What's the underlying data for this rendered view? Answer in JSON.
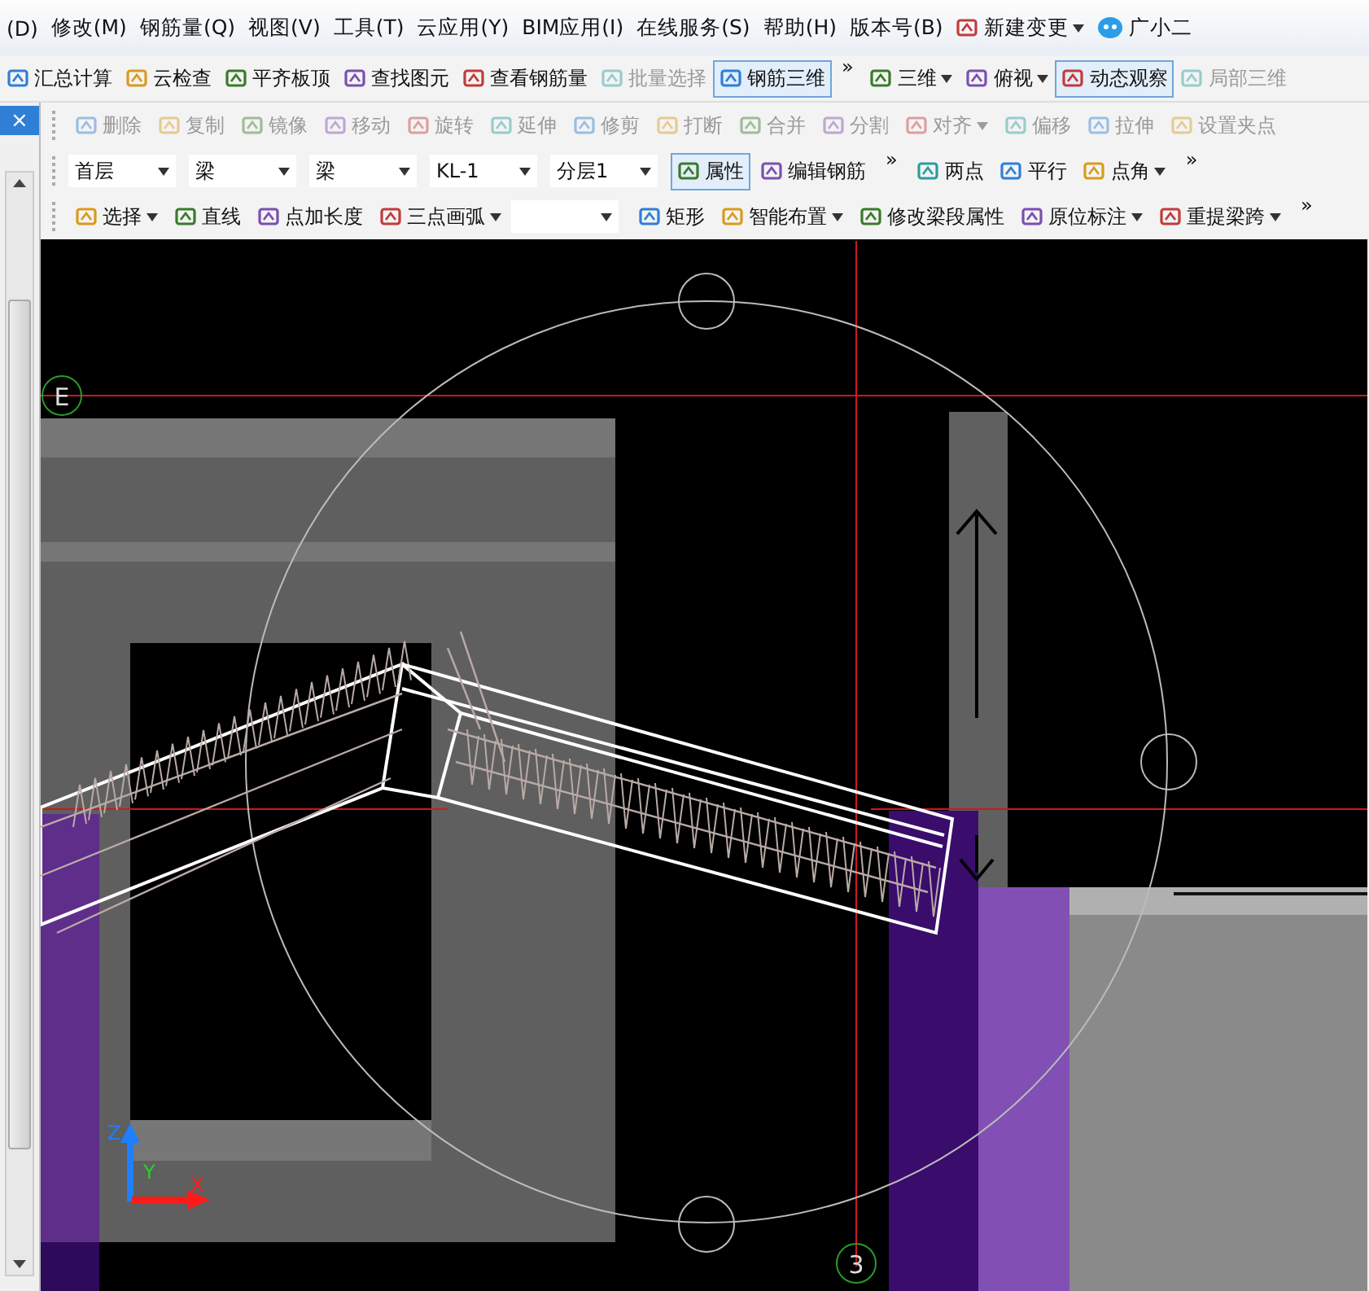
{
  "menu_bar": {
    "items": [
      {
        "label": "(D)",
        "kind": "menu"
      },
      {
        "label": "修改(M)",
        "kind": "menu"
      },
      {
        "label": "钢筋量(Q)",
        "kind": "menu"
      },
      {
        "label": "视图(V)",
        "kind": "menu"
      },
      {
        "label": "工具(T)",
        "kind": "menu"
      },
      {
        "label": "云应用(Y)",
        "kind": "menu"
      },
      {
        "label": "BIM应用(I)",
        "kind": "menu"
      },
      {
        "label": "在线服务(S)",
        "kind": "menu"
      },
      {
        "label": "帮助(H)",
        "kind": "menu"
      },
      {
        "label": "版本号(B)",
        "kind": "menu"
      },
      {
        "label": "新建变更",
        "kind": "dropdown"
      },
      {
        "label": "广小二",
        "kind": "button"
      }
    ]
  },
  "main_toolbar": [
    {
      "label": "汇总计算",
      "selected": false,
      "disabled": false,
      "dropdown": false
    },
    {
      "label": "云检查",
      "selected": false,
      "disabled": false,
      "dropdown": false
    },
    {
      "label": "平齐板顶",
      "selected": false,
      "disabled": false,
      "dropdown": false
    },
    {
      "label": "查找图元",
      "selected": false,
      "disabled": false,
      "dropdown": false
    },
    {
      "label": "查看钢筋量",
      "selected": false,
      "disabled": false,
      "dropdown": false
    },
    {
      "label": "批量选择",
      "selected": false,
      "disabled": true,
      "dropdown": false
    },
    {
      "label": "钢筋三维",
      "selected": true,
      "disabled": false,
      "dropdown": false
    },
    {
      "label": "»",
      "kind": "overflow"
    },
    {
      "label": "三维",
      "selected": false,
      "disabled": false,
      "dropdown": true
    },
    {
      "label": "俯视",
      "selected": false,
      "disabled": false,
      "dropdown": true
    },
    {
      "label": "动态观察",
      "selected": true,
      "disabled": false,
      "dropdown": false
    },
    {
      "label": "局部三维",
      "selected": false,
      "disabled": true,
      "dropdown": false
    }
  ],
  "side_panel": {
    "close": "×"
  },
  "edit_toolbar": [
    {
      "label": "删除",
      "disabled": true,
      "dropdown": false
    },
    {
      "label": "复制",
      "disabled": true,
      "dropdown": false
    },
    {
      "label": "镜像",
      "disabled": true,
      "dropdown": false
    },
    {
      "label": "移动",
      "disabled": true,
      "dropdown": false
    },
    {
      "label": "旋转",
      "disabled": true,
      "dropdown": false
    },
    {
      "label": "延伸",
      "disabled": true,
      "dropdown": false
    },
    {
      "label": "修剪",
      "disabled": true,
      "dropdown": false
    },
    {
      "label": "打断",
      "disabled": true,
      "dropdown": false
    },
    {
      "label": "合并",
      "disabled": true,
      "dropdown": false
    },
    {
      "label": "分割",
      "disabled": true,
      "dropdown": false
    },
    {
      "label": "对齐",
      "disabled": true,
      "dropdown": true
    },
    {
      "label": "偏移",
      "disabled": true,
      "dropdown": false
    },
    {
      "label": "拉伸",
      "disabled": true,
      "dropdown": false
    },
    {
      "label": "设置夹点",
      "disabled": true,
      "dropdown": false
    }
  ],
  "selector_bar": {
    "selects": [
      {
        "value": "首层"
      },
      {
        "value": "梁"
      },
      {
        "value": "梁"
      },
      {
        "value": "KL-1"
      },
      {
        "value": "分层1"
      }
    ],
    "buttons": [
      {
        "label": "属性",
        "selected": true,
        "dropdown": false
      },
      {
        "label": "编辑钢筋",
        "selected": false,
        "dropdown": false
      },
      {
        "label": "»",
        "kind": "overflow"
      },
      {
        "label": "两点",
        "selected": false,
        "dropdown": false
      },
      {
        "label": "平行",
        "selected": false,
        "dropdown": false
      },
      {
        "label": "点角",
        "selected": false,
        "dropdown": true
      },
      {
        "label": "»",
        "kind": "overflow"
      }
    ]
  },
  "draw_toolbar": [
    {
      "label": "选择",
      "kind": "button",
      "dropdown": true
    },
    {
      "label": "直线",
      "kind": "button",
      "dropdown": false
    },
    {
      "label": "点加长度",
      "kind": "button",
      "dropdown": false
    },
    {
      "label": "三点画弧",
      "kind": "button",
      "dropdown": true
    },
    {
      "kind": "select"
    },
    {
      "label": "矩形",
      "kind": "button",
      "dropdown": false
    },
    {
      "label": "智能布置",
      "kind": "button",
      "dropdown": true
    },
    {
      "label": "修改梁段属性",
      "kind": "button",
      "dropdown": false
    },
    {
      "label": "原位标注",
      "kind": "button",
      "dropdown": true
    },
    {
      "label": "重提梁跨",
      "kind": "button",
      "dropdown": true
    },
    {
      "label": "»",
      "kind": "overflow"
    }
  ],
  "canvas": {
    "axis_labels": [
      "E",
      "3"
    ],
    "ucs": {
      "z": "Z",
      "y": "Y",
      "x": "X"
    }
  }
}
